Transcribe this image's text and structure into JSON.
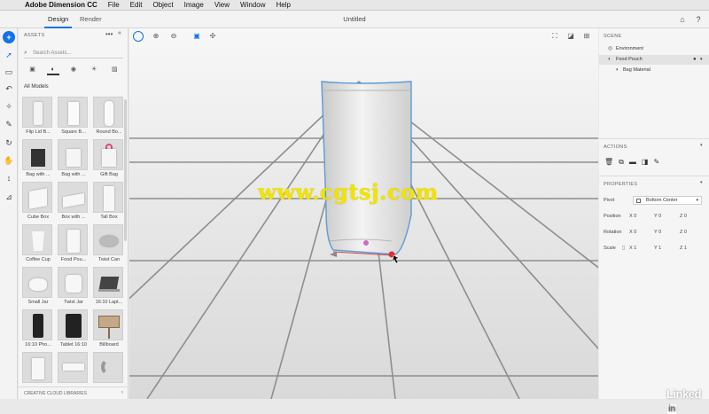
{
  "menubar": {
    "apple_icon": "apple-icon",
    "app_name": "Adobe Dimension CC",
    "items": [
      "File",
      "Edit",
      "Object",
      "Image",
      "View",
      "Window",
      "Help"
    ]
  },
  "appbar": {
    "tabs": [
      {
        "label": "Design",
        "active": true
      },
      {
        "label": "Render",
        "active": false
      }
    ],
    "document_title": "Untitled"
  },
  "toolbar": {
    "tools": [
      "add-icon",
      "select-icon",
      "rectangle-select-icon",
      "undo-icon",
      "magic-wand-icon",
      "eyedropper-icon",
      "orbit-icon",
      "pan-icon",
      "dolly-icon",
      "measure-icon"
    ]
  },
  "assets": {
    "header": "ASSETS",
    "more": "•••",
    "search_placeholder": "Search Assets...",
    "section_title": "All Models",
    "models": [
      "Flip Lid B...",
      "Square B...",
      "Round Bo...",
      "Bag with ...",
      "Bag with ...",
      "Gift Bag",
      "Cube Box",
      "Box with ...",
      "Tall Box",
      "Coffee Cup",
      "Food Pou...",
      "Twist Can",
      "Small Jar",
      "Twist Jar",
      "16:10 Lapt...",
      "16:10 Pho...",
      "Tablet 16:10",
      "Billboard",
      "",
      "",
      ""
    ],
    "footer": "CREATIVE CLOUD LIBRARIES"
  },
  "viewport": {
    "watermark": "www.cgtsj.com"
  },
  "scene": {
    "title": "SCENE",
    "items": [
      {
        "label": "Environment",
        "icon": "globe-icon",
        "selected": false
      },
      {
        "label": "Food Pouch",
        "icon": "model-icon",
        "selected": true
      },
      {
        "label": "Bag Material",
        "icon": "material-icon",
        "selected": false
      }
    ],
    "actions_title": "ACTIONS",
    "properties_title": "PROPERTIES",
    "pivot_label": "Pivot",
    "pivot_value": "Bottom Center",
    "position_label": "Position",
    "rotation_label": "Rotation",
    "scale_label": "Scale",
    "position": {
      "x": "0",
      "y": "0",
      "z": "0"
    },
    "rotation": {
      "x": "0",
      "y": "0",
      "z": "0"
    },
    "scale": {
      "x": "1",
      "y": "1",
      "z": "1"
    }
  },
  "branding": {
    "linkedin_text": "Linked",
    "linkedin_in": "in"
  },
  "colors": {
    "accent": "#1473e6",
    "watermark": "#f2e400"
  }
}
